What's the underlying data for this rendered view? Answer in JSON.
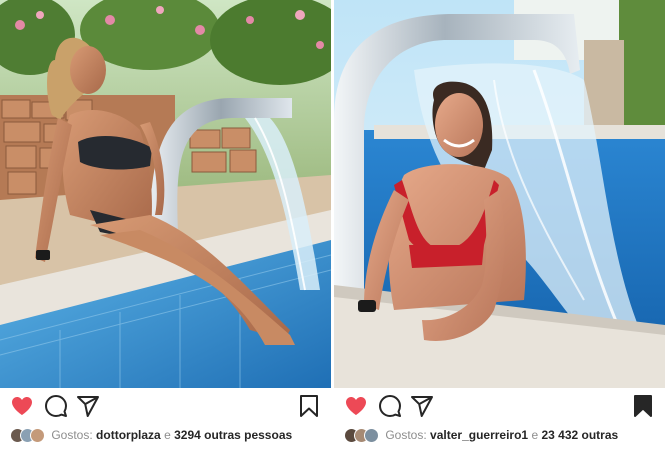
{
  "colors": {
    "heart": "#ed4956",
    "icon_stroke": "#262626",
    "bookmark_fill": "#262626",
    "water": "#3b8fd4",
    "sky": "#bfe4f7"
  },
  "icons": [
    "heart-icon",
    "comment-icon",
    "share-icon",
    "bookmark-icon"
  ],
  "posts": [
    {
      "liked": true,
      "saved": false,
      "likes_prefix": "Gostos:",
      "first_liker": "dottorplaza",
      "connector": "e",
      "others": "3294 outras pessoas"
    },
    {
      "liked": true,
      "saved": true,
      "likes_prefix": "Gostos:",
      "first_liker": "valter_guerreiro1",
      "connector": "e",
      "others": "23 432 outras"
    }
  ]
}
